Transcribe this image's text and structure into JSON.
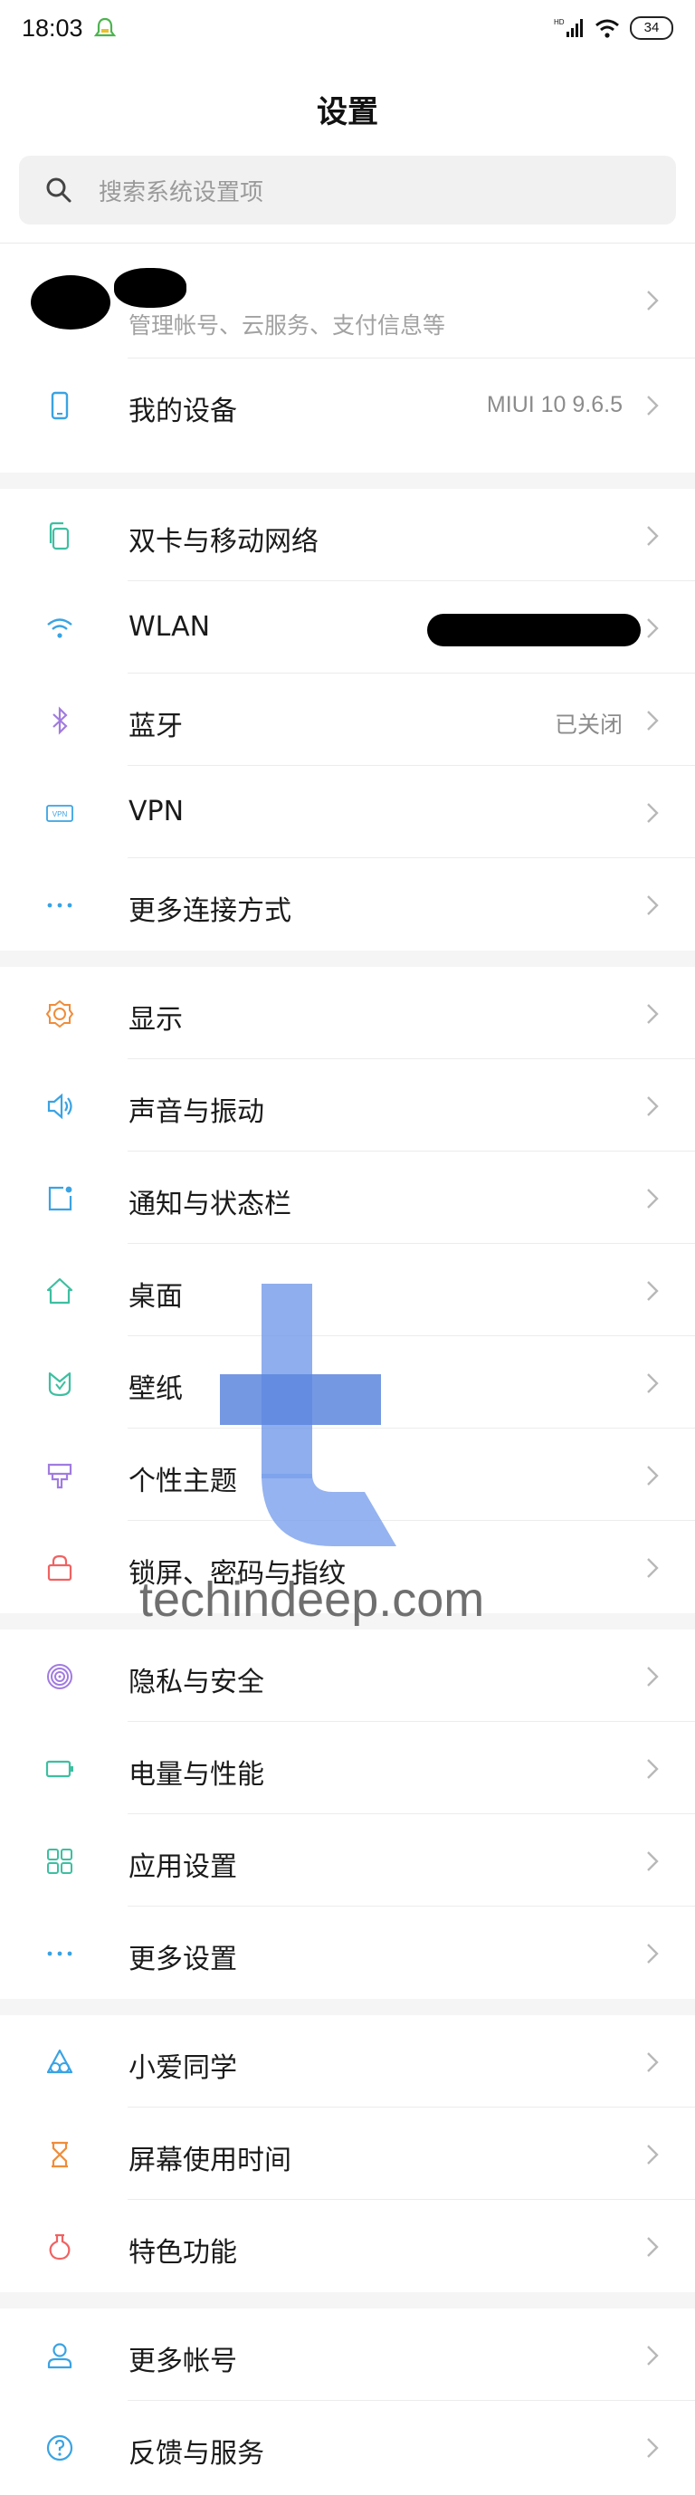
{
  "status": {
    "time": "18:03",
    "battery": "34",
    "network": "HD"
  },
  "header": {
    "title": "设置"
  },
  "search": {
    "placeholder": "搜索系统设置项"
  },
  "account": {
    "subtitle": "管理帐号、云服务、支付信息等"
  },
  "device": {
    "label": "我的设备",
    "value": "MIUI 10 9.6.5"
  },
  "connectivity": [
    {
      "label": "双卡与移动网络",
      "icon": "dual-sim-icon",
      "value": ""
    },
    {
      "label": "WLAN",
      "icon": "wifi-icon",
      "value": ""
    },
    {
      "label": "蓝牙",
      "icon": "bluetooth-icon",
      "value": "已关闭"
    },
    {
      "label": "VPN",
      "icon": "vpn-icon",
      "value": ""
    },
    {
      "label": "更多连接方式",
      "icon": "more-dots-icon",
      "value": ""
    }
  ],
  "personalization": [
    {
      "label": "显示",
      "icon": "brightness-icon"
    },
    {
      "label": "声音与振动",
      "icon": "speaker-icon"
    },
    {
      "label": "通知与状态栏",
      "icon": "notification-icon"
    },
    {
      "label": "桌面",
      "icon": "home-icon"
    },
    {
      "label": "壁纸",
      "icon": "wallpaper-icon"
    },
    {
      "label": "个性主题",
      "icon": "theme-brush-icon"
    },
    {
      "label": "锁屏、密码与指纹",
      "icon": "lock-icon"
    }
  ],
  "system": [
    {
      "label": "隐私与安全",
      "icon": "fingerprint-icon"
    },
    {
      "label": "电量与性能",
      "icon": "battery-icon"
    },
    {
      "label": "应用设置",
      "icon": "apps-grid-icon"
    },
    {
      "label": "更多设置",
      "icon": "more-dots-icon"
    }
  ],
  "features": [
    {
      "label": "小爱同学",
      "icon": "xiaoai-icon"
    },
    {
      "label": "屏幕使用时间",
      "icon": "hourglass-icon"
    },
    {
      "label": "特色功能",
      "icon": "feature-flask-icon"
    }
  ],
  "accounts": [
    {
      "label": "更多帐号",
      "icon": "user-icon"
    },
    {
      "label": "反馈与服务",
      "icon": "help-question-icon"
    }
  ],
  "watermark": {
    "text": "techindeep.com"
  },
  "colors": {
    "accent_blue": "#3aa3e3",
    "orange": "#f08c3a",
    "green": "#3dbfa0",
    "purple": "#a17be0",
    "red": "#f06262",
    "chevron": "#b8b8b8"
  }
}
